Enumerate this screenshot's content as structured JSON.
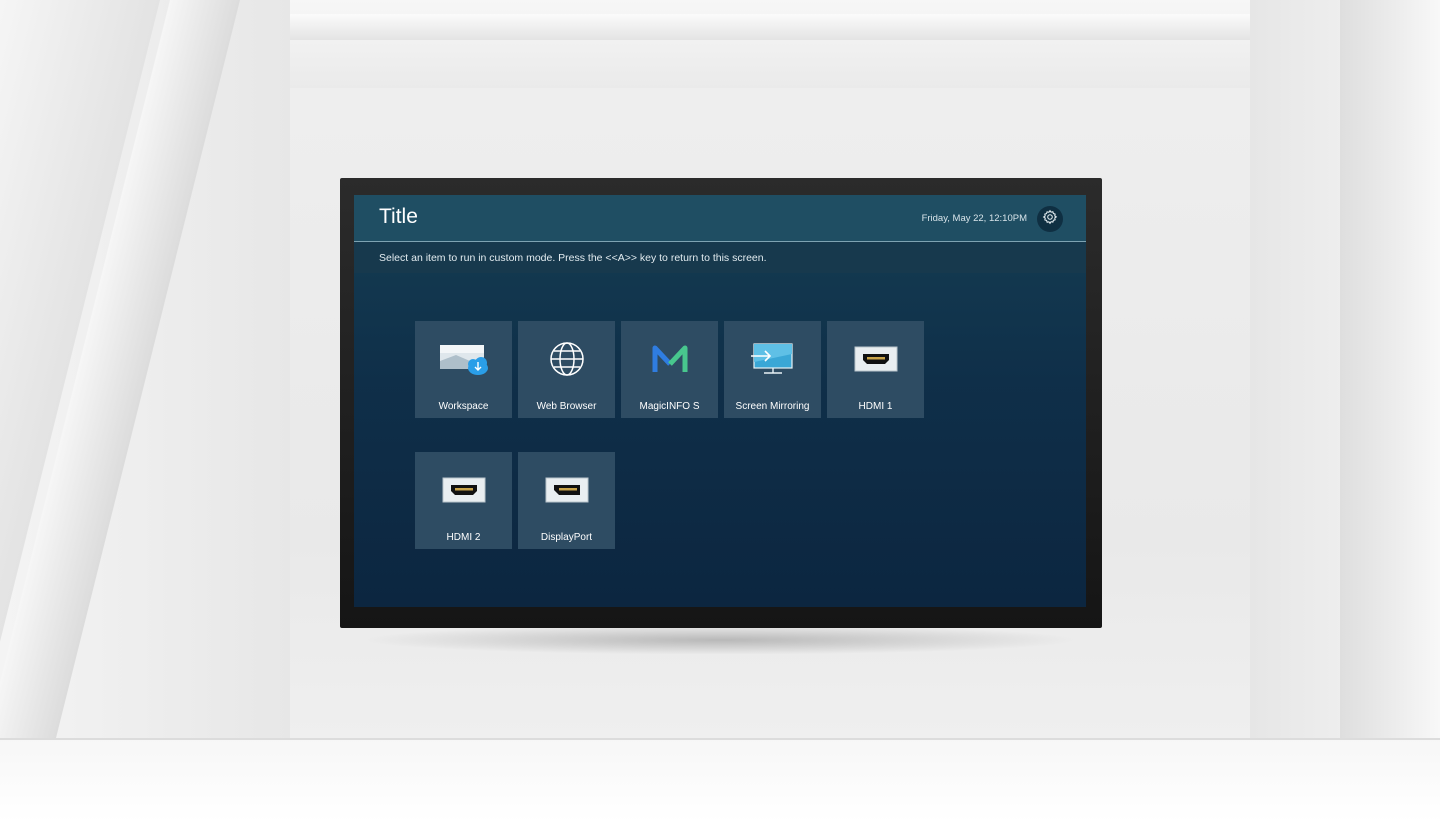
{
  "header": {
    "title": "Title",
    "datetime": "Friday, May 22, 12:10PM",
    "settings_icon": "gear-icon"
  },
  "instruction": "Select an item to run in custom mode. Press the <<A>> key to return to this screen.",
  "tiles": [
    {
      "label": "Workspace",
      "icon": "workspace-icon"
    },
    {
      "label": "Web Browser",
      "icon": "globe-icon"
    },
    {
      "label": "MagicINFO S",
      "icon": "magicinfo-icon"
    },
    {
      "label": "Screen Mirroring",
      "icon": "screen-mirroring-icon"
    },
    {
      "label": "HDMI 1",
      "icon": "hdmi-port-icon"
    },
    {
      "label": "HDMI 2",
      "icon": "hdmi-port-icon"
    },
    {
      "label": "DisplayPort",
      "icon": "displayport-icon"
    }
  ],
  "colors": {
    "header_bar": "#1f4e63",
    "tile": "#2e4c63",
    "screen_bottom": "#0c2640",
    "magicinfo_blue": "#2f7de1",
    "magicinfo_green": "#48c78e",
    "cloud_blue": "#2a9ee8"
  }
}
